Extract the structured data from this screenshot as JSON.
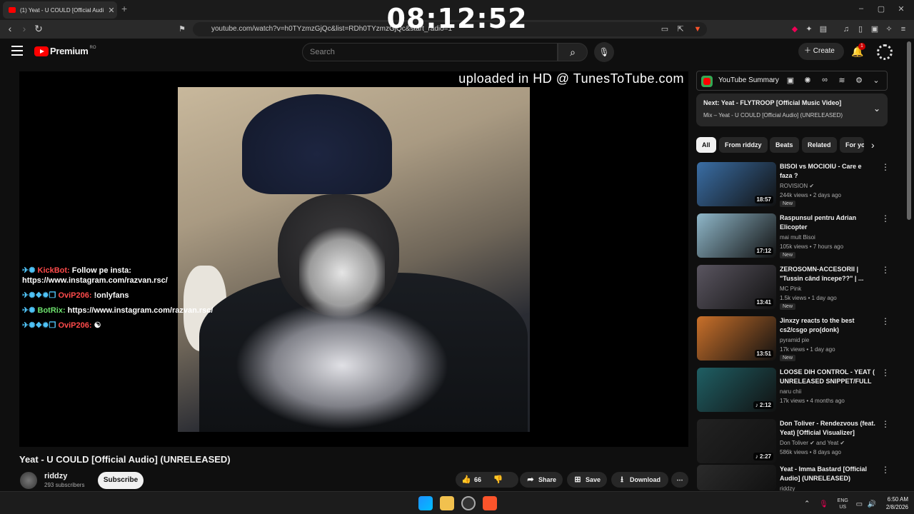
{
  "browser": {
    "tab_title": "(1) Yeat - U COULD [Official Audi",
    "new_tab": "+",
    "url": "youtube.com/watch?v=h0TYzmzGjQc&list=RDh0TYzmzGjQc&start_radio=1",
    "clock_overlay": "08:12:52"
  },
  "header": {
    "logo_text": "Premium",
    "region": "RO",
    "search_placeholder": "Search",
    "create_label": "Create",
    "notification_count": "1"
  },
  "player": {
    "watermark": "uploaded in HD @ TunesToTube.com",
    "chat": [
      {
        "emotes": "✈✺",
        "nick": "KickBot:",
        "nick_color": "#ff4b4b",
        "msg": "Follow pe insta: https://www.instagram.com/razvan.rsc/"
      },
      {
        "emotes": "✈✺❖✹❒",
        "nick": "OviP206:",
        "nick_color": "#ff4b4b",
        "msg": "!onlyfans"
      },
      {
        "emotes": "✈✺",
        "nick": "BotRix:",
        "nick_color": "#6ee36e",
        "msg": "https://www.instagram.com/razvan.rsc/"
      },
      {
        "emotes": "✈✺❖✹❒",
        "nick": "OviP206:",
        "nick_color": "#ff4b4b",
        "msg": "☯"
      }
    ]
  },
  "video": {
    "title": "Yeat - U COULD [Official Audio] (UNRELEASED)",
    "channel": "riddzy",
    "subscribers": "293 subscribers",
    "subscribe_label": "Subscribe",
    "likes": "66",
    "share_label": "Share",
    "save_label": "Save",
    "download_label": "Download"
  },
  "sidebar": {
    "summary_label": "YouTube Summary",
    "next_title": "Next: Yeat - FLYTROOP [Official Music Video]",
    "next_sub": "Mix – Yeat - U COULD [Official Audio] (UNRELEASED)",
    "chips": [
      "All",
      "From riddzy",
      "Beats",
      "Related",
      "For yo"
    ],
    "recommendations": [
      {
        "title": "BISOI vs MOCIOIU - Care e faza ?",
        "channel": "ROVISION",
        "verified": "✔",
        "meta": "244k views • 2 days ago",
        "badge": "New",
        "duration": "18:57",
        "thumb": "#3a6ea5"
      },
      {
        "title": "Raspunsul pentru Adrian Elicopter",
        "channel": "mai mult Bisoi",
        "verified": "",
        "meta": "105k views • 7 hours ago",
        "badge": "New",
        "duration": "17:12",
        "thumb": "#8fb7c9"
      },
      {
        "title": "ZEROSOMN-ACCESORII | \"Tussin când începe??\" | ...",
        "channel": "MC Pink",
        "verified": "",
        "meta": "1.5k views • 1 day ago",
        "badge": "New",
        "duration": "13:41",
        "thumb": "#5a5560"
      },
      {
        "title": "Jinxzy reacts to the best cs2/csgo pro(donk)",
        "channel": "pyramid pie",
        "verified": "",
        "meta": "17k views • 1 day ago",
        "badge": "New",
        "duration": "13:51",
        "thumb": "#c9702a"
      },
      {
        "title": "LOOSE DIH CONTROL - YEAT ( UNRELEASED SNIPPET/FULL ...",
        "channel": "naru chii",
        "verified": "",
        "meta": "17k views • 4 months ago",
        "badge": "",
        "duration": "♪ 2:12",
        "thumb": "#1f5f64"
      },
      {
        "title": "Don Toliver - Rendezvous (feat. Yeat) [Official Visualizer]",
        "channel": "Don Toliver ✔ and Yeat ✔",
        "verified": "",
        "meta": "586k views • 8 days ago",
        "badge": "",
        "duration": "♪ 2:27",
        "thumb": "#222"
      },
      {
        "title": "Yeat - Imma Bastard [Official Audio] (UNRELEASED)",
        "channel": "riddzy",
        "verified": "",
        "meta": "",
        "badge": "",
        "duration": "",
        "thumb": "#2b2b2b"
      }
    ]
  },
  "taskbar": {
    "lang": "ENG",
    "region": "US",
    "time": "6:50 AM",
    "date": "2/8/2026"
  }
}
